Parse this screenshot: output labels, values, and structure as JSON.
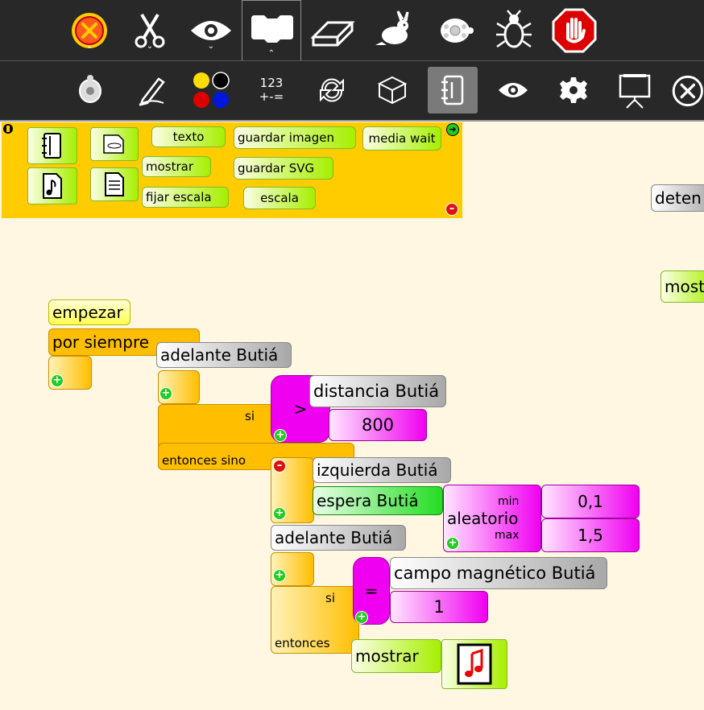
{
  "toolbar_main": {
    "items": [
      "stop-icon",
      "cut-icon",
      "eye-icon",
      "tab-icon",
      "eraser-icon",
      "rabbit-icon",
      "turtle-icon",
      "bug-icon",
      "stop-hand-icon"
    ]
  },
  "toolbar_palette": {
    "numbers_label_top": "123",
    "numbers_label_bottom": "+-=",
    "items": [
      "turtle-icon",
      "pen-icon",
      "colors-icon",
      "numbers-icon",
      "flow-icon",
      "blocks-icon",
      "media-icon",
      "eye-icon",
      "gear-icon",
      "presentation-icon",
      "close-icon"
    ]
  },
  "palette": {
    "texto": "texto",
    "mostrar": "mostrar",
    "fijar_escala": "fijar escala",
    "guardar_imagen": "guardar imagen",
    "guardar_svg": "guardar SVG",
    "escala": "escala",
    "media_wait": "media wait"
  },
  "canvas": {
    "deten": "deten",
    "most": "most",
    "empezar": "empezar",
    "por_siempre": "por siempre",
    "adelante_butia_1": "adelante Butiá",
    "si_1": "si",
    "entonces_sino": "entonces sino",
    "gt": ">",
    "distancia_butia": "distancia Butiá",
    "value_800": "800",
    "izquierda_butia": "izquierda Butiá",
    "espera_butia": "espera Butiá",
    "aleatorio": "aleatorio",
    "min": "min",
    "max": "max",
    "min_value": "0,1",
    "max_value": "1,5",
    "adelante_butia_2": "adelante Butiá",
    "si_2": "si",
    "entonces": "entonces",
    "eq": "=",
    "campo_magnetico": "campo magnético Butiá",
    "value_1": "1",
    "mostrar": "mostrar"
  },
  "colors": {
    "toolbar_bg": "#282828",
    "canvas_bg": "#fff7e1",
    "palette_bg": "#ffcc00",
    "flow": "#ffbe00",
    "number": "#f000f0",
    "sensor_grey": "#a8a8a8",
    "media_green": "#a6ef00"
  }
}
